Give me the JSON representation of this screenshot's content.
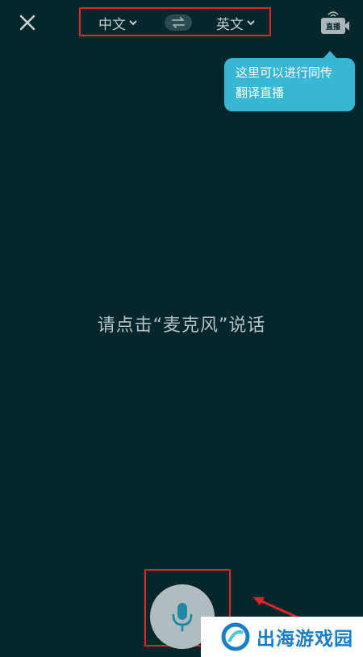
{
  "header": {
    "source_lang": "中文",
    "target_lang": "英文",
    "live_label": "直播"
  },
  "tooltip": {
    "line1": "这里可以进行同传",
    "line2": "翻译直播"
  },
  "main": {
    "prompt": "请点击“麦克风”说话"
  },
  "watermark": {
    "text": "出海游戏园"
  },
  "colors": {
    "background": "#04272c",
    "tooltip_bg": "#39b6d3",
    "mic_icon": "#1f8aa3",
    "highlight_border": "#e0252b",
    "watermark_text": "#1a7ec4"
  },
  "icons": {
    "close": "close-icon",
    "swap": "swap-icon",
    "live": "live-broadcast-camera-icon",
    "mic": "microphone-icon"
  }
}
